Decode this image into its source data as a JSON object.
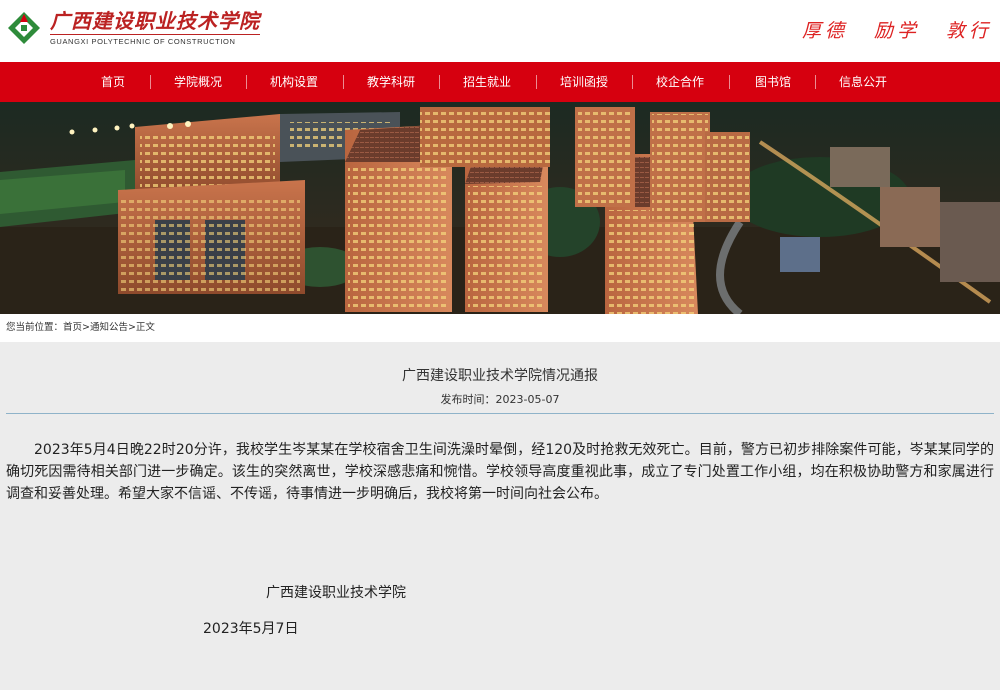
{
  "header": {
    "school_name_cn": "广西建设职业技术学院",
    "school_name_en": "GUANGXI POLYTECHNIC OF CONSTRUCTION",
    "motto": [
      "厚德",
      "励学",
      "敦行"
    ],
    "brand_colors": {
      "red": "#d6000f",
      "green": "#2e8b3a"
    }
  },
  "nav": {
    "items": [
      "首页",
      "学院概况",
      "机构设置",
      "教学科研",
      "招生就业",
      "培训函授",
      "校企合作",
      "图书馆",
      "信息公开"
    ]
  },
  "breadcrumb": {
    "prefix": "您当前位置：",
    "path": "首页>通知公告>正文"
  },
  "article": {
    "title": "广西建设职业技术学院情况通报",
    "publish_time_label": "发布时间：",
    "publish_time": "2023-05-07",
    "body": "2023年5月4日晚22时20分许，我校学生岑某某在学校宿舍卫生间洗澡时晕倒，经120及时抢救无效死亡。目前，警方已初步排除案件可能，岑某某同学的确切死因需待相关部门进一步确定。该生的突然离世，学校深感悲痛和惋惜。学校领导高度重视此事，成立了专门处置工作小组，均在积极协助警方和家属进行调查和妥善处理。希望大家不信谣、不传谣，待事情进一步明确后，我校将第一时间向社会公布。",
    "signature_org": "广西建设职业技术学院",
    "signature_date": "2023年5月7日"
  }
}
